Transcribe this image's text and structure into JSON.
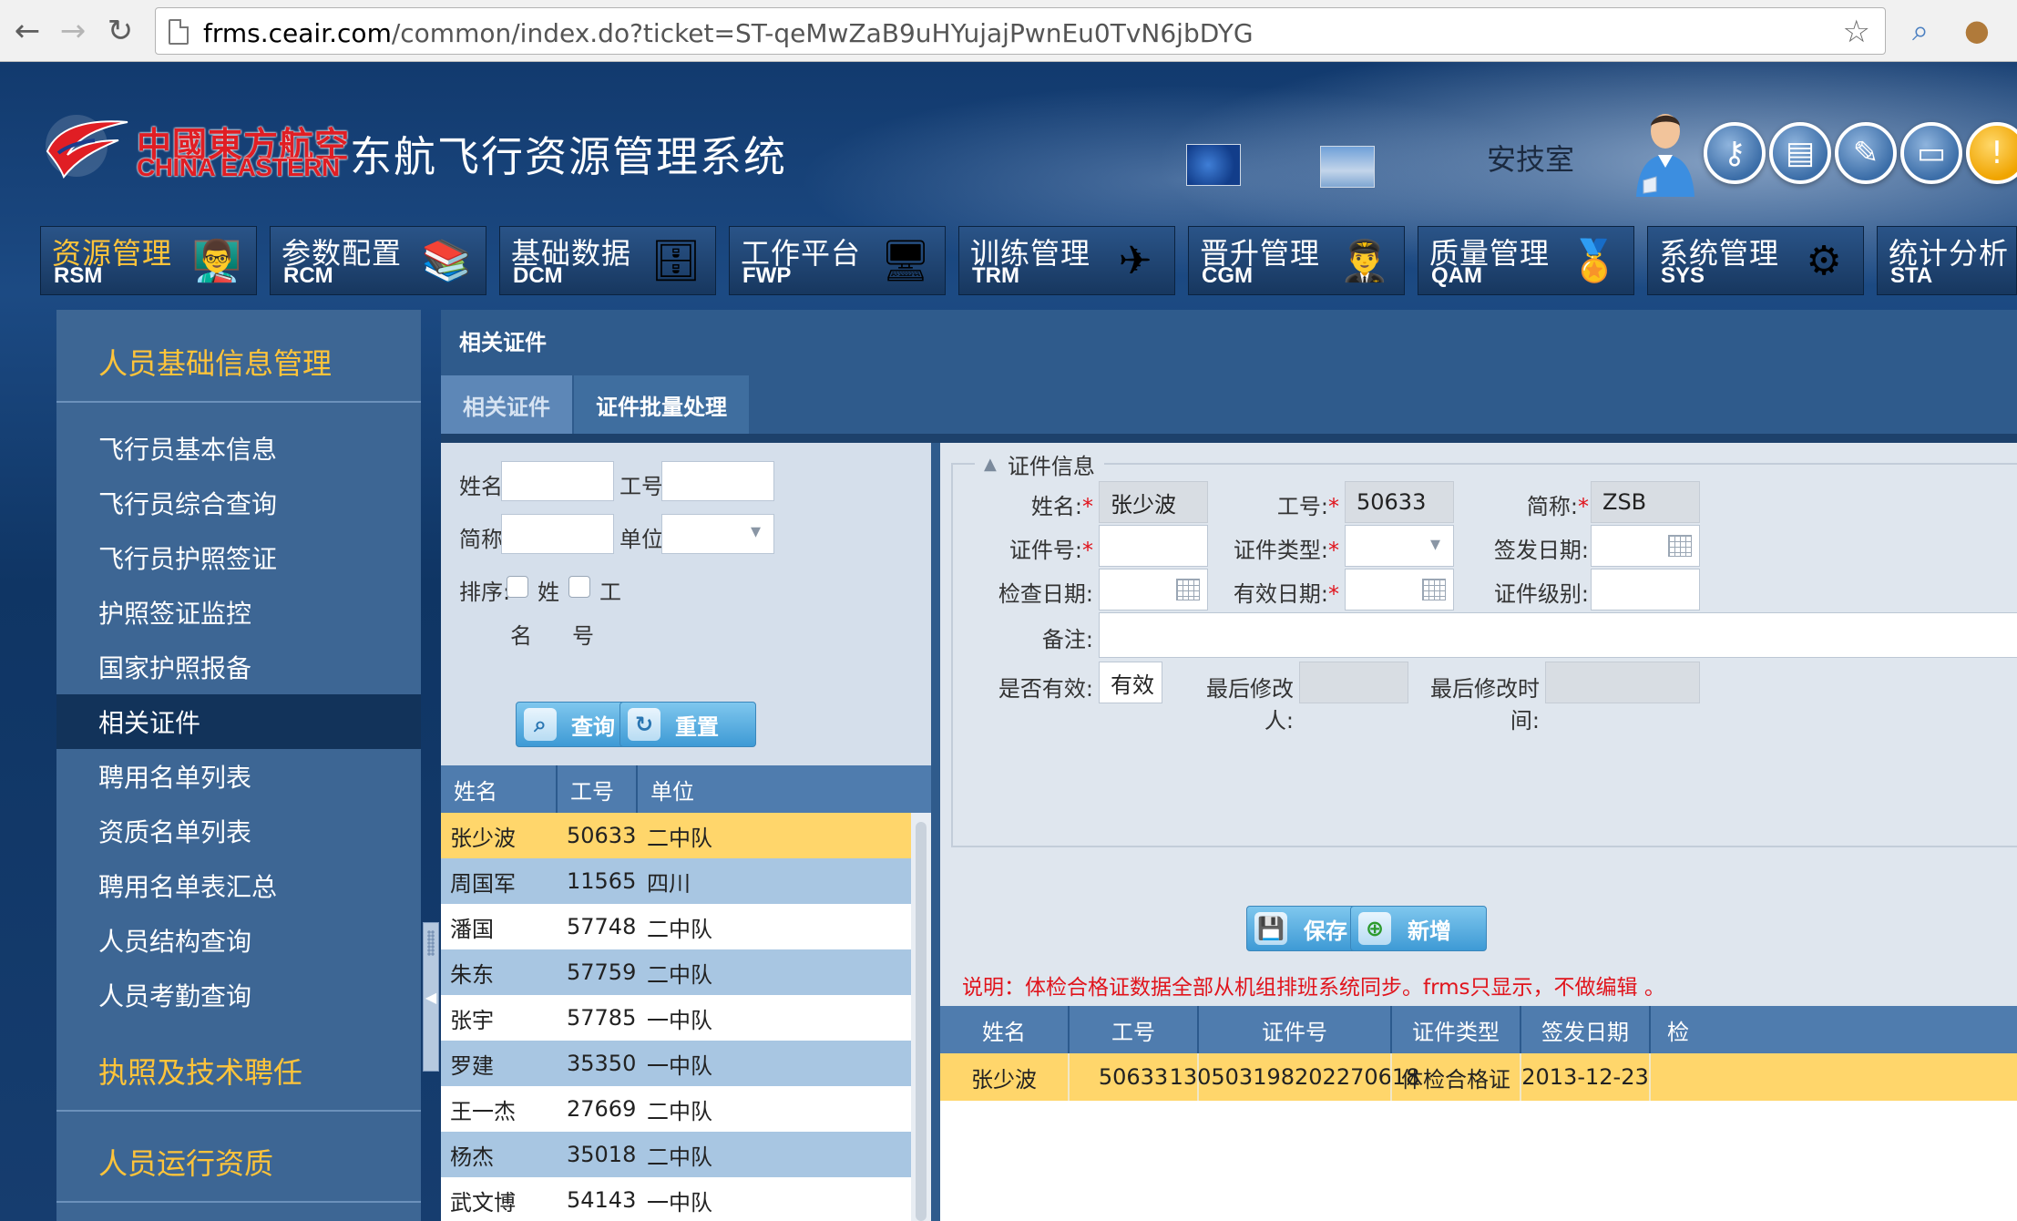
{
  "browser": {
    "url_host": "frms.ceair.com",
    "url_path": "/common/index.do?ticket=ST-qeMwZaB9uHYujajPwnEu0TvN6jbDYG"
  },
  "header": {
    "logo_cn": "中國東方航空",
    "logo_en": "CHINA EASTERN",
    "system_title": "东航飞行资源管理系统",
    "department": "安技室",
    "brand_color": "#e01e24"
  },
  "modules": [
    {
      "cn": "资源管理",
      "en": "RSM",
      "icon": "people-board-icon"
    },
    {
      "cn": "参数配置",
      "en": "RCM",
      "icon": "books-gear-icon"
    },
    {
      "cn": "基础数据",
      "en": "DCM",
      "icon": "database-icon"
    },
    {
      "cn": "工作平台",
      "en": "FWP",
      "icon": "computer-icon"
    },
    {
      "cn": "训练管理",
      "en": "TRM",
      "icon": "airplane-icon"
    },
    {
      "cn": "晋升管理",
      "en": "CGM",
      "icon": "pilot-icon"
    },
    {
      "cn": "质量管理",
      "en": "QAM",
      "icon": "medal-icon"
    },
    {
      "cn": "系统管理",
      "en": "SYS",
      "icon": "gear-icon"
    },
    {
      "cn": "统计分析",
      "en": "STA",
      "icon": "chart-icon"
    }
  ],
  "sidebar": {
    "group1": "人员基础信息管理",
    "items": [
      "飞行员基本信息",
      "飞行员综合查询",
      "飞行员护照签证",
      "护照签证监控",
      "国家护照报备",
      "相关证件",
      "聘用名单列表",
      "资质名单列表",
      "聘用名单表汇总",
      "人员结构查询",
      "人员考勤查询"
    ],
    "active_item": "相关证件",
    "group2": "执照及技术聘任",
    "group3": "人员运行资质"
  },
  "content": {
    "title": "相关证件",
    "tabs": [
      "相关证件",
      "证件批量处理"
    ]
  },
  "search": {
    "name_label": "姓名:",
    "empno_label": "工号:",
    "abbr_label": "简称:",
    "unit_label": "单位:",
    "sort_label": "排序:",
    "sort_name_a": "姓",
    "sort_name_b": "名",
    "sort_no_a": "工",
    "sort_no_b": "号",
    "query_btn": "查询",
    "reset_btn": "重置",
    "columns": [
      "姓名",
      "工号",
      "单位"
    ],
    "rows": [
      {
        "name": "张少波",
        "no": "50633",
        "unit": "二中队"
      },
      {
        "name": "周国军",
        "no": "11565",
        "unit": "四川"
      },
      {
        "name": "潘国",
        "no": "57748",
        "unit": "二中队"
      },
      {
        "name": "朱东",
        "no": "57759",
        "unit": "二中队"
      },
      {
        "name": "张宇",
        "no": "57785",
        "unit": "一中队"
      },
      {
        "name": "罗建",
        "no": "35350",
        "unit": "一中队"
      },
      {
        "name": "王一杰",
        "no": "27669",
        "unit": "二中队"
      },
      {
        "name": "杨杰",
        "no": "35018",
        "unit": "二中队"
      },
      {
        "name": "武文博",
        "no": "54143",
        "unit": "一中队"
      }
    ]
  },
  "detail": {
    "legend": "证件信息",
    "name_label": "姓名:",
    "name_value": "张少波",
    "empno_label": "工号:",
    "empno_value": "50633",
    "abbr_label": "简称:",
    "abbr_value": "ZSB",
    "certno_label": "证件号:",
    "certtype_label": "证件类型:",
    "issue_label": "签发日期:",
    "check_label": "检查日期:",
    "valid_label": "有效日期:",
    "level_label": "证件级别:",
    "remark_label": "备注:",
    "effective_label": "是否有效:",
    "effective_value": "有效",
    "modifier_label": "最后修改人:",
    "modtime_label": "最后修改时间:",
    "save_btn": "保存",
    "add_btn": "新增",
    "note": "说明：体检合格证数据全部从机组排班系统同步。frms只显示，不做编辑 。",
    "grid_columns": [
      "姓名",
      "工号",
      "证件号",
      "证件类型",
      "签发日期",
      "检"
    ],
    "grid_rows": [
      {
        "name": "张少波",
        "no": "50633",
        "certno": "130503198202270618",
        "type": "体检合格证",
        "issue": "2013-12-23"
      }
    ]
  }
}
